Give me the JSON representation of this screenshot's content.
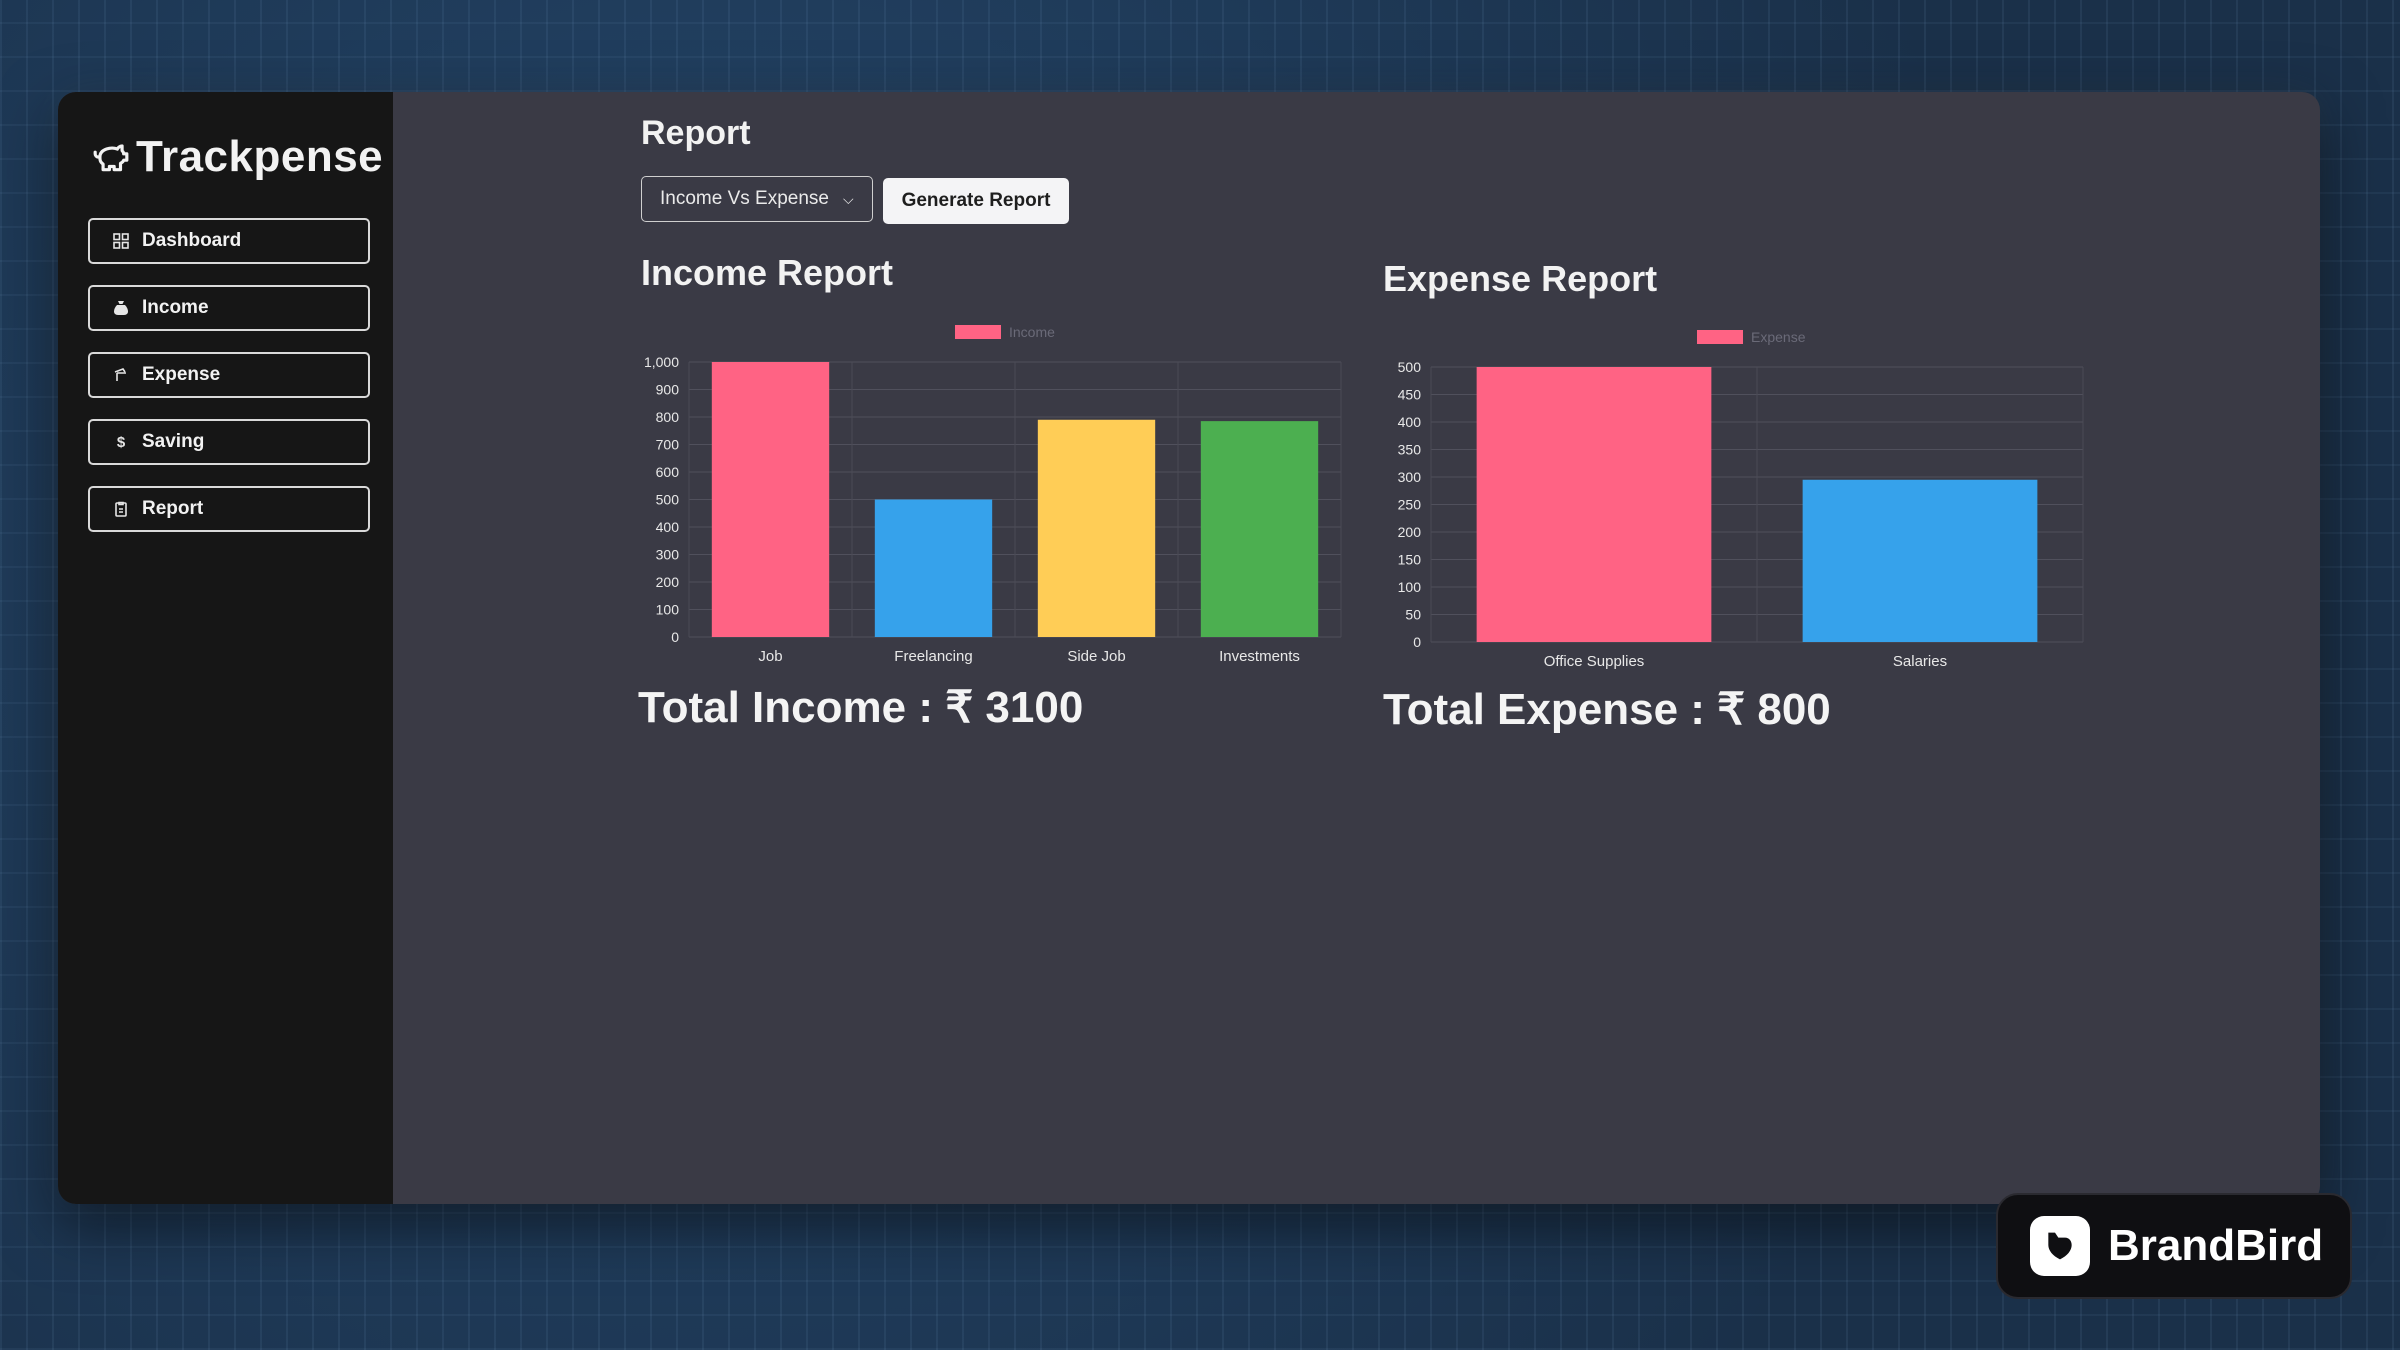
{
  "app": {
    "name": "Trackpense"
  },
  "sidebar": {
    "items": [
      {
        "label": "Dashboard",
        "icon": "dashboard-icon"
      },
      {
        "label": "Income",
        "icon": "money-bag-icon"
      },
      {
        "label": "Expense",
        "icon": "wallet-icon"
      },
      {
        "label": "Saving",
        "icon": "dollar-icon"
      },
      {
        "label": "Report",
        "icon": "report-icon"
      }
    ]
  },
  "main": {
    "title": "Report",
    "report_type": {
      "selected": "Income Vs Expense"
    },
    "generate_button": "Generate Report",
    "income": {
      "title": "Income Report",
      "total": "Total Income : ₹ 3100"
    },
    "expense": {
      "title": "Expense Report",
      "total": "Total Expense : ₹ 800"
    }
  },
  "watermark": {
    "text": "BrandBird"
  },
  "colors": {
    "sidebar_bg": "#161616",
    "main_bg": "#3a3a45",
    "pink": "#ff6384",
    "blue": "#36a2eb",
    "yellow": "#ffcd56",
    "green": "#4caf50"
  },
  "chart_data": [
    {
      "type": "bar",
      "categories": [
        "Job",
        "Freelancing",
        "Side Job",
        "Investments"
      ],
      "series": [
        {
          "name": "Income",
          "values": [
            1000,
            500,
            790,
            785
          ]
        }
      ],
      "bar_colors": [
        "#ff6384",
        "#36a2eb",
        "#ffcd56",
        "#4caf50"
      ],
      "ylim": [
        0,
        1000
      ],
      "yticks": [
        0,
        100,
        200,
        300,
        400,
        500,
        600,
        700,
        800,
        900,
        1000
      ],
      "ytick_labels": [
        "0",
        "100",
        "200",
        "300",
        "400",
        "500",
        "600",
        "700",
        "800",
        "900",
        "1,000"
      ],
      "legend_placement": "top-center",
      "grid": true
    },
    {
      "type": "bar",
      "categories": [
        "Office Supplies",
        "Salaries"
      ],
      "series": [
        {
          "name": "Expense",
          "values": [
            500,
            295
          ]
        }
      ],
      "bar_colors": [
        "#ff6384",
        "#36a2eb"
      ],
      "ylim": [
        0,
        500
      ],
      "yticks": [
        0,
        50,
        100,
        150,
        200,
        250,
        300,
        350,
        400,
        450,
        500
      ],
      "ytick_labels": [
        "0",
        "50",
        "100",
        "150",
        "200",
        "250",
        "300",
        "350",
        "400",
        "450",
        "500"
      ],
      "legend_placement": "top-center",
      "grid": true
    }
  ]
}
